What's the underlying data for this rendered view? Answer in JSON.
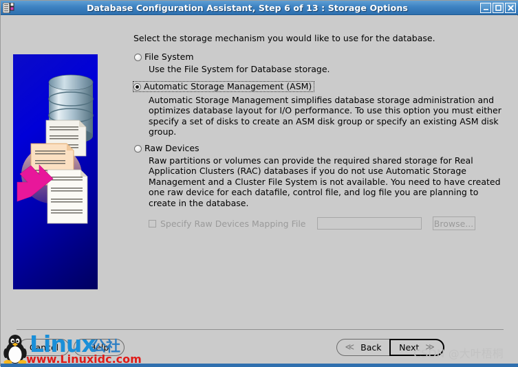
{
  "window": {
    "title": "Database Configuration Assistant, Step 6 of 13 : Storage Options",
    "icon": "application-icon",
    "controls": {
      "minimize": "_",
      "maximize": "□",
      "close": "✕"
    }
  },
  "main": {
    "intro": "Select the storage mechanism you would like to use for the database.",
    "options": [
      {
        "id": "file-system",
        "label": "File System",
        "selected": false,
        "focused": false,
        "description": "Use the File System for Database storage."
      },
      {
        "id": "asm",
        "label": "Automatic Storage Management (ASM)",
        "selected": true,
        "focused": true,
        "description": "Automatic Storage Management simplifies database storage administration and optimizes database layout for I/O performance. To use this option you must either specify a set of disks to create an ASM disk group or specify an existing ASM disk group."
      },
      {
        "id": "raw-devices",
        "label": "Raw Devices",
        "selected": false,
        "focused": false,
        "description": "Raw partitions or volumes can provide the required shared storage for Real Application Clusters (RAC) databases if you do not use Automatic Storage Management and a Cluster File System is not available.  You need to have created one raw device for each datafile, control file, and log file you are planning to create in the database."
      }
    ],
    "mapping": {
      "checkbox_label": "Specify Raw Devices Mapping File",
      "checked": false,
      "enabled": false,
      "field_value": "",
      "field_placeholder": "",
      "browse_label": "Browse..."
    }
  },
  "footer": {
    "cancel_label": "Cancel",
    "cancel_mnemonic": "C",
    "help_label": "Help",
    "help_mnemonic": "H",
    "back_label": "Back",
    "back_mnemonic": "B",
    "next_label": "Next",
    "next_mnemonic": "N",
    "back_chevron": "≪",
    "next_chevron": "≫"
  },
  "watermarks": {
    "linux_brand": "Linux",
    "linux_brand_cn": "公社",
    "linux_url": "www.Linuxidc.com",
    "csdn": "CSDN @大叶梧桐"
  },
  "colors": {
    "titlebar": "#3d82c2",
    "panel": "#cbcbcb",
    "illustration_bg": "#0000c8",
    "arrow": "#e8179a",
    "disabled_text": "#9a9a9a"
  }
}
